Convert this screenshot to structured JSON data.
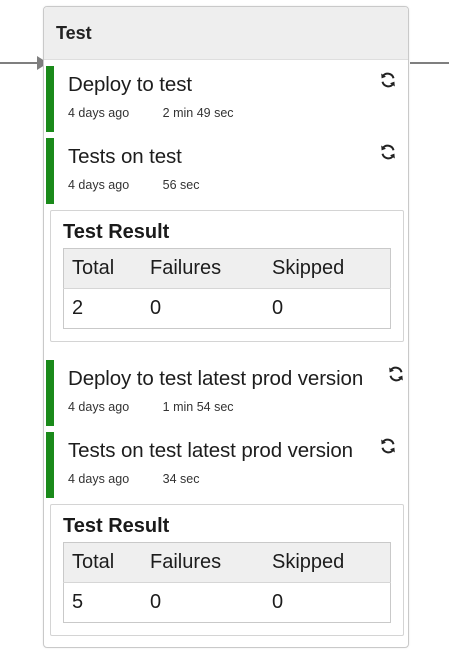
{
  "stage": {
    "title": "Test"
  },
  "jobs": [
    {
      "title": "Deploy to test",
      "ago": "4 days ago",
      "duration": "2 min 49 sec",
      "status_color": "#1a8a1a",
      "icon": "refresh-icon"
    },
    {
      "title": "Tests on test",
      "ago": "4 days ago",
      "duration": "56 sec",
      "status_color": "#1a8a1a",
      "icon": "refresh-icon"
    },
    {
      "title": "Deploy to test latest prod version",
      "ago": "4 days ago",
      "duration": "1 min 54 sec",
      "status_color": "#1a8a1a",
      "icon": "refresh-icon"
    },
    {
      "title": "Tests on test latest prod version",
      "ago": "4 days ago",
      "duration": "34 sec",
      "status_color": "#1a8a1a",
      "icon": "refresh-icon"
    }
  ],
  "test_results": [
    {
      "title": "Test Result",
      "headers": [
        "Total",
        "Failures",
        "Skipped"
      ],
      "values": [
        "2",
        "0",
        "0"
      ]
    },
    {
      "title": "Test Result",
      "headers": [
        "Total",
        "Failures",
        "Skipped"
      ],
      "values": [
        "5",
        "0",
        "0"
      ]
    }
  ],
  "colors": {
    "success": "#1a8a1a",
    "connector": "#7f7f7f",
    "header_bg": "#eeeeee"
  }
}
